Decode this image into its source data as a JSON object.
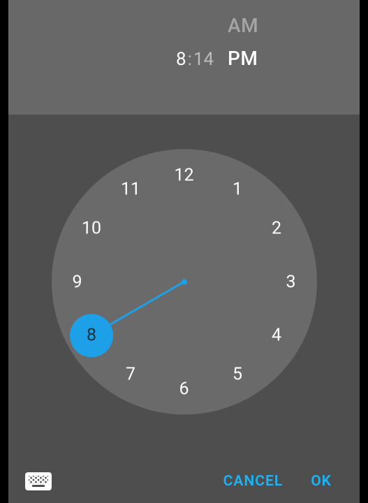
{
  "header": {
    "am_label": "AM",
    "pm_label": "PM",
    "selected_period": "PM",
    "hour": "8",
    "colon": ":",
    "minute": "14"
  },
  "clock": {
    "hours": [
      "12",
      "1",
      "2",
      "3",
      "4",
      "5",
      "6",
      "7",
      "8",
      "9",
      "10",
      "11"
    ],
    "selected_hour": 8,
    "face_radius": 190,
    "label_radius": 153
  },
  "footer": {
    "cancel": "CANCEL",
    "ok": "OK"
  },
  "colors": {
    "accent": "#1ea0e8",
    "dialog_bg": "#4e4e4e",
    "header_bg": "#686868",
    "face_bg": "#6a6a6a"
  }
}
